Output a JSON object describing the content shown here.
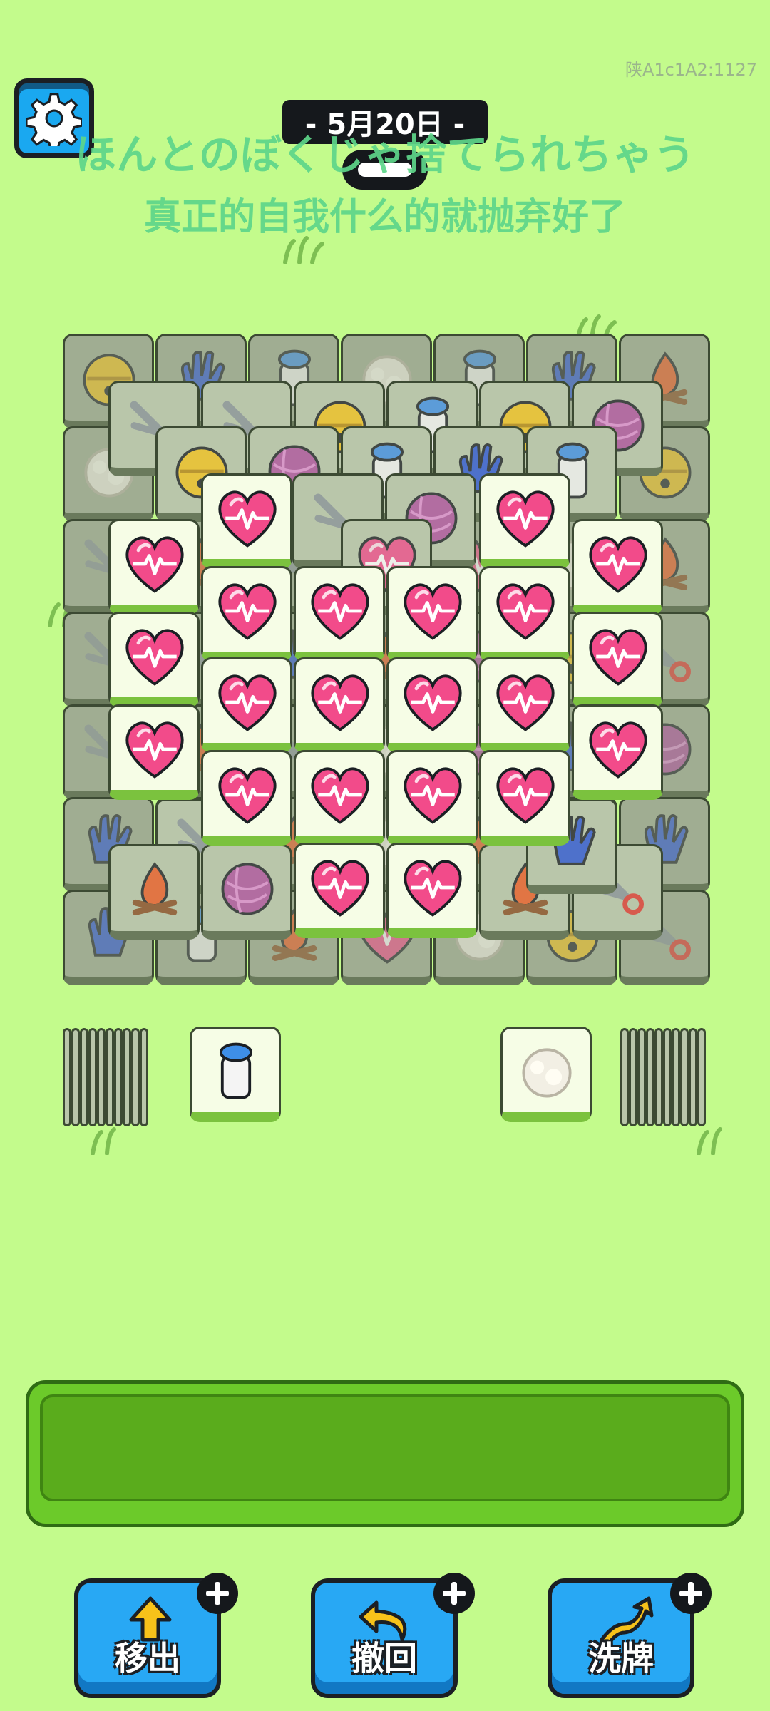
{
  "watermark": "陕A1c1A2:1127",
  "header": {
    "date": "- 5月20日 -",
    "lyric_line_1": "ほんとのぼくじゃ捨てられちゃう",
    "lyric_line_2": "真正的自我什么的就抛弃好了"
  },
  "icons": {
    "settings": "gear-icon",
    "tile_symbols": [
      "heart-icon",
      "bell-icon",
      "glove-icon",
      "milk-bottle-icon",
      "cotton-icon",
      "scissors-icon",
      "yarn-icon",
      "campfire-icon"
    ]
  },
  "side_stacks": {
    "left_visible_tile": "milk-bottle-icon",
    "right_visible_tile": "cotton-icon"
  },
  "tray": {
    "empty": true
  },
  "powerups": [
    {
      "label": "移出",
      "icon": "move-out-icon"
    },
    {
      "label": "撤回",
      "icon": "undo-icon"
    },
    {
      "label": "洗牌",
      "icon": "shuffle-icon"
    }
  ],
  "colors": {
    "background": "#c3fb8c",
    "heart": "#f24b8a",
    "button_blue": "#28a8f4",
    "tray_green": "#6cca2a"
  }
}
